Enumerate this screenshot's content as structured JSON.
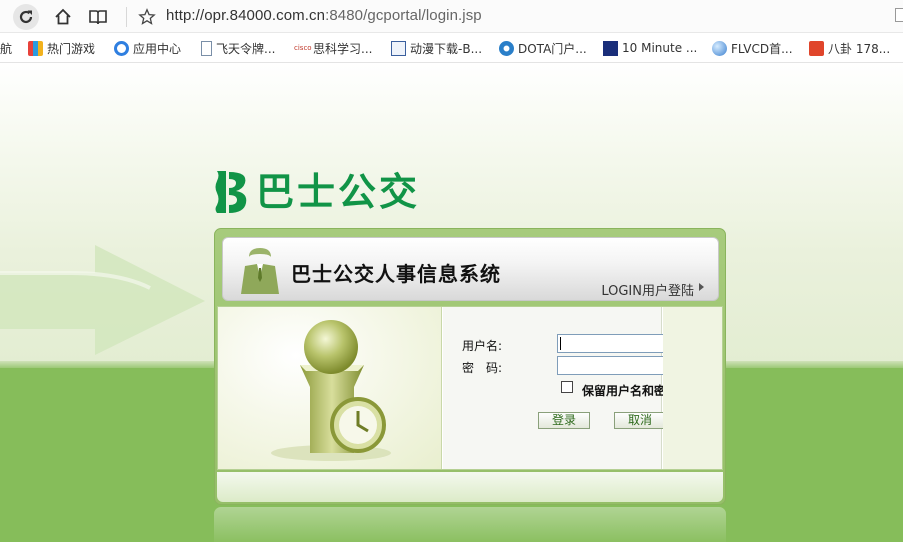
{
  "browser": {
    "url_main": "http://opr.84000.com.cn",
    "url_rest": ":8480/gcportal/login.jsp",
    "bookmarks": [
      {
        "label": "航",
        "icon": "partial-icon"
      },
      {
        "label": "热门游戏",
        "icon": "games-icon"
      },
      {
        "label": "应用中心",
        "icon": "app-center-icon"
      },
      {
        "label": "飞天令牌...",
        "icon": "page-icon"
      },
      {
        "label": "思科学习...",
        "icon": "cisco-icon"
      },
      {
        "label": "动漫下载-B...",
        "icon": "anime-icon"
      },
      {
        "label": "DOTA门户...",
        "icon": "dota-icon"
      },
      {
        "label": "10 Minute ...",
        "icon": "tenminute-icon"
      },
      {
        "label": "FLVCD首...",
        "icon": "globe-icon"
      },
      {
        "label": "八卦 178...",
        "icon": "bagua-icon"
      }
    ]
  },
  "brand": {
    "logo_text": "巴士公交"
  },
  "panel": {
    "title": "巴士公交人事信息系统",
    "login_tag": "LOGIN用户登陆",
    "username_label": "用户名:",
    "password_label": "密　码:",
    "username_value": "",
    "password_value": "",
    "remember_label": "保留用户名和密码",
    "login_button": "登录",
    "cancel_button": "取消"
  },
  "colors": {
    "brand_green": "#119447",
    "band_green": "#86bd5a"
  }
}
